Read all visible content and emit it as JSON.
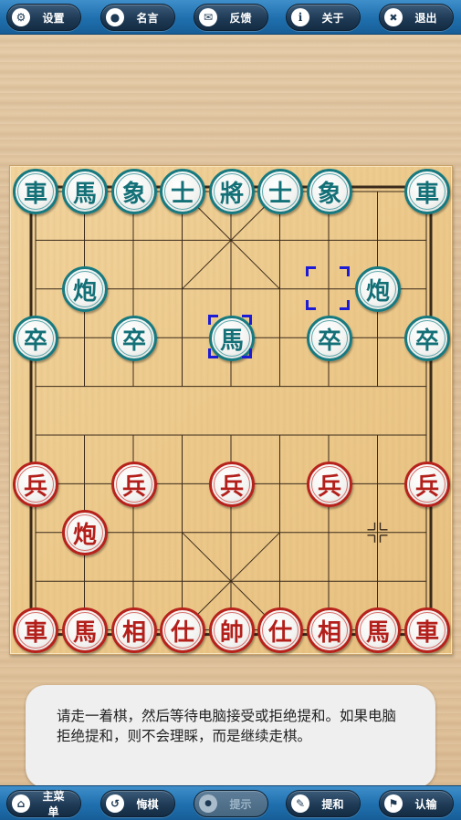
{
  "top_bar": {
    "settings": {
      "label": "设置",
      "icon": "gear-icon",
      "glyph": "⚙"
    },
    "quote": {
      "label": "名言",
      "icon": "speech-bubble-icon",
      "glyph": "●"
    },
    "feedback": {
      "label": "反馈",
      "icon": "envelope-icon",
      "glyph": "✉"
    },
    "about": {
      "label": "关于",
      "icon": "info-icon",
      "glyph": "i"
    },
    "exit": {
      "label": "退出",
      "icon": "close-icon",
      "glyph": "✖"
    }
  },
  "board": {
    "line_color": "#3a2a1a",
    "pieces": {
      "black_back": [
        "車",
        "馬",
        "象",
        "士",
        "將",
        "士",
        "象",
        "",
        "車"
      ],
      "black_cannon_left": "炮",
      "black_cannon_right": "炮",
      "black_horse_moved": "馬",
      "black_soldiers": [
        "卒",
        "卒",
        "卒",
        "卒"
      ],
      "red_soldiers": [
        "兵",
        "兵",
        "兵",
        "兵",
        "兵"
      ],
      "red_cannon": "炮",
      "red_back": [
        "車",
        "馬",
        "相",
        "仕",
        "帥",
        "仕",
        "相",
        "馬",
        "車"
      ]
    },
    "colors": {
      "black_piece": "#147077",
      "red_piece": "#b31f1a",
      "selection": "#1c1cd6"
    }
  },
  "message": {
    "text": "请走一着棋，然后等待电脑接受或拒绝提和。如果电脑拒绝提和，则不会理睬，而是继续走棋。"
  },
  "bottom_bar": {
    "main_menu": {
      "label": "主菜单",
      "icon": "home-icon",
      "glyph": "⌂"
    },
    "undo": {
      "label": "悔棋",
      "icon": "undo-icon",
      "glyph": "↺"
    },
    "hint": {
      "label": "提示",
      "icon": "lightbulb-icon",
      "glyph": "●"
    },
    "draw": {
      "label": "提和",
      "icon": "pen-icon",
      "glyph": "✎"
    },
    "resign": {
      "label": "认输",
      "icon": "flag-icon",
      "glyph": "⚑"
    }
  }
}
